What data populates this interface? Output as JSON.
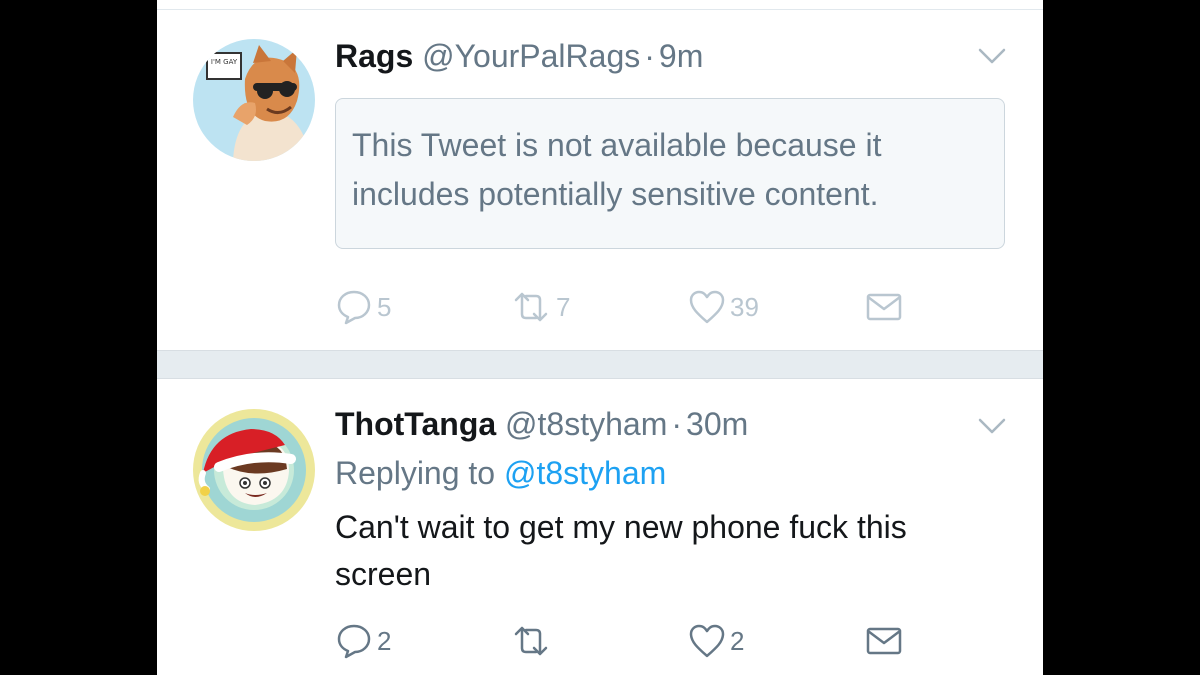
{
  "tweets": [
    {
      "display_name": "Rags",
      "handle": "@YourPalRags",
      "separator": "·",
      "time": "9m",
      "avatar_sign_text": "I'M GAY",
      "notice": "This Tweet is not available because it includes potentially sensitive content.",
      "actions": {
        "replies": "5",
        "retweets": "7",
        "likes": "39"
      }
    },
    {
      "display_name": "ThotTanga",
      "handle": "@t8styham",
      "separator": "·",
      "time": "30m",
      "replying_prefix": "Replying to",
      "replying_handle": "@t8styham",
      "text": "Can't wait to get my new phone  fuck this screen",
      "actions": {
        "replies": "2",
        "retweets": "",
        "likes": "2"
      }
    }
  ],
  "colors": {
    "link": "#1da1f2",
    "secondary": "#657786",
    "faded": "#b9c6d0"
  }
}
